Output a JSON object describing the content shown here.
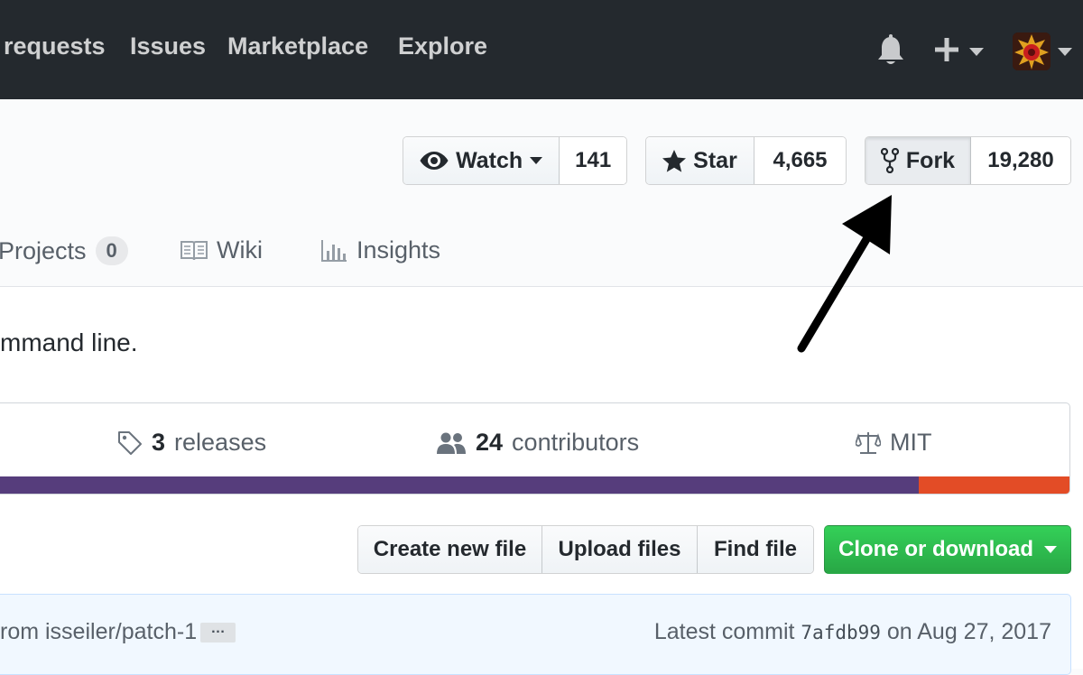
{
  "nav": {
    "links": [
      "requests",
      "Issues",
      "Marketplace",
      "Explore"
    ],
    "icons": [
      "bell-icon",
      "plus-icon",
      "chevron-down-icon",
      "avatar"
    ]
  },
  "repo_actions": {
    "watch": {
      "label": "Watch",
      "count": "141"
    },
    "star": {
      "label": "Star",
      "count": "4,665"
    },
    "fork": {
      "label": "Fork",
      "count": "19,280"
    }
  },
  "reponav": {
    "projects": {
      "label": "Projects",
      "count": "0"
    },
    "wiki": {
      "label": "Wiki"
    },
    "insights": {
      "label": "Insights"
    }
  },
  "description": "mmand line.",
  "summary": {
    "releases": {
      "count": "3",
      "label": "releases"
    },
    "contributors": {
      "count": "24",
      "label": "contributors"
    },
    "license": "MIT",
    "languages": [
      {
        "fraction": 0.86,
        "color": "#563d7c"
      },
      {
        "fraction": 0.14,
        "color": "#e34c26"
      }
    ]
  },
  "file_actions": {
    "create": "Create new file",
    "upload": "Upload files",
    "find": "Find file",
    "clone": "Clone or download"
  },
  "commit": {
    "message": "rom isseiler/patch-1",
    "ellipsis": "…",
    "latest_prefix": "Latest commit",
    "sha": "7afdb99",
    "date": "on Aug 27, 2017"
  },
  "colors": {
    "accent_green": "#28a745",
    "header_bg": "#24292e"
  }
}
